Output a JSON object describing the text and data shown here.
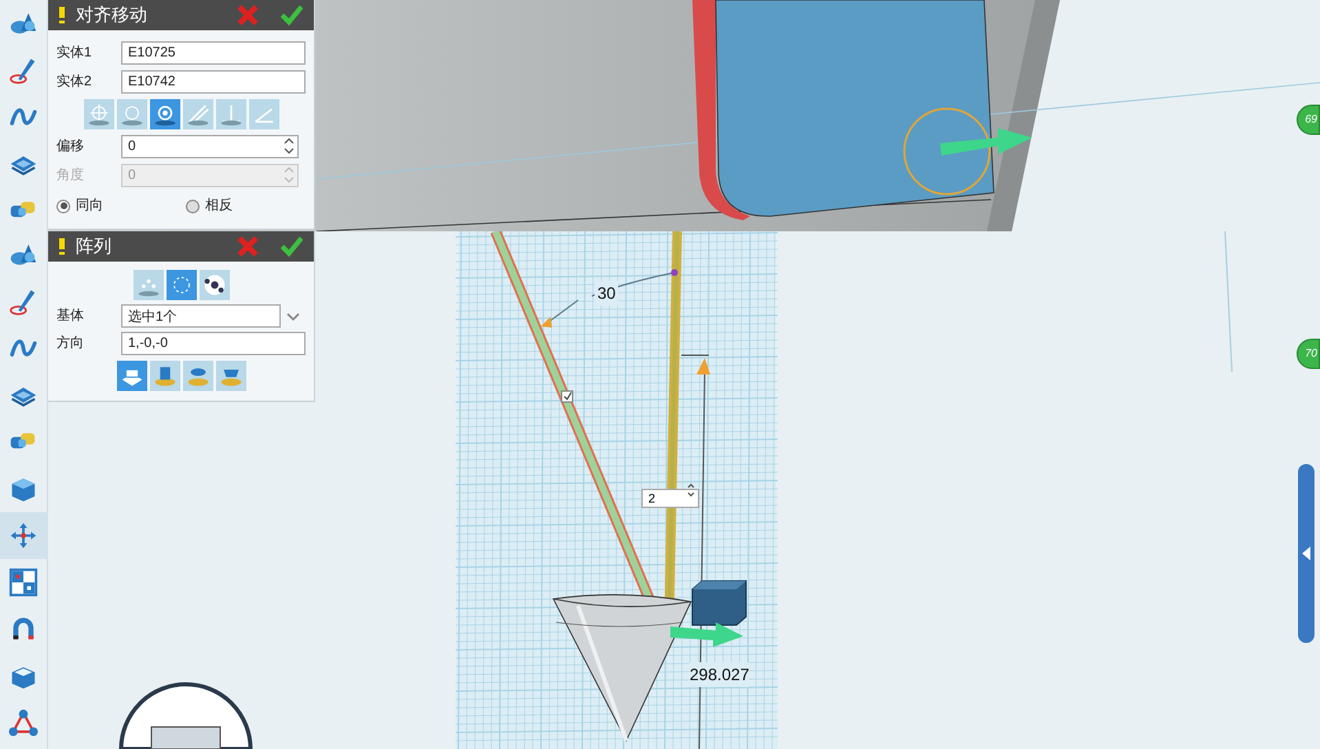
{
  "top_view": {
    "toolbar": [
      {
        "kind": "primitive",
        "selected": false
      },
      {
        "kind": "sketch",
        "selected": false
      },
      {
        "kind": "curve",
        "selected": false
      },
      {
        "kind": "edit",
        "selected": false
      },
      {
        "kind": "combine",
        "selected": false
      }
    ],
    "panel": {
      "title": "对齐移动",
      "fields": [
        {
          "label": "实体1",
          "value": "E10725"
        },
        {
          "label": "实体2",
          "value": "E10742"
        }
      ],
      "modes": [
        {
          "selected": false
        },
        {
          "selected": false
        },
        {
          "selected": true
        },
        {
          "selected": false
        },
        {
          "selected": false
        },
        {
          "selected": false
        }
      ],
      "spinners": [
        {
          "label": "偏移",
          "value": "0",
          "disabled": false
        },
        {
          "label": "角度",
          "value": "0",
          "disabled": true
        }
      ],
      "direction_options": [
        {
          "label": "同向",
          "selected": true
        },
        {
          "label": "相反",
          "selected": false
        }
      ]
    },
    "badge": "69"
  },
  "bottom_view": {
    "toolbar": [
      {
        "kind": "primitive",
        "selected": false
      },
      {
        "kind": "sketch",
        "selected": false
      },
      {
        "kind": "curve",
        "selected": false
      },
      {
        "kind": "edit",
        "selected": false
      },
      {
        "kind": "combine",
        "selected": false
      },
      {
        "kind": "box",
        "selected": false
      },
      {
        "kind": "move",
        "selected": true
      },
      {
        "kind": "array",
        "selected": false
      },
      {
        "kind": "magnet",
        "selected": false
      },
      {
        "kind": "shell",
        "selected": false
      },
      {
        "kind": "network",
        "selected": false
      }
    ],
    "panel": {
      "title": "阵列",
      "modes": [
        {
          "selected": false
        },
        {
          "selected": true
        },
        {
          "selected": false
        }
      ],
      "fields": [
        {
          "kind": "dropdown",
          "label": "基体",
          "value": "选中1个"
        },
        {
          "kind": "text",
          "label": "方向",
          "value": "1,-0,-0"
        }
      ],
      "options": [
        {
          "selected": true
        },
        {
          "selected": false
        },
        {
          "selected": false
        },
        {
          "selected": false
        }
      ]
    },
    "angle_label": "30",
    "count_spinner": "2",
    "distance_label": "298.027",
    "badge": "70"
  }
}
